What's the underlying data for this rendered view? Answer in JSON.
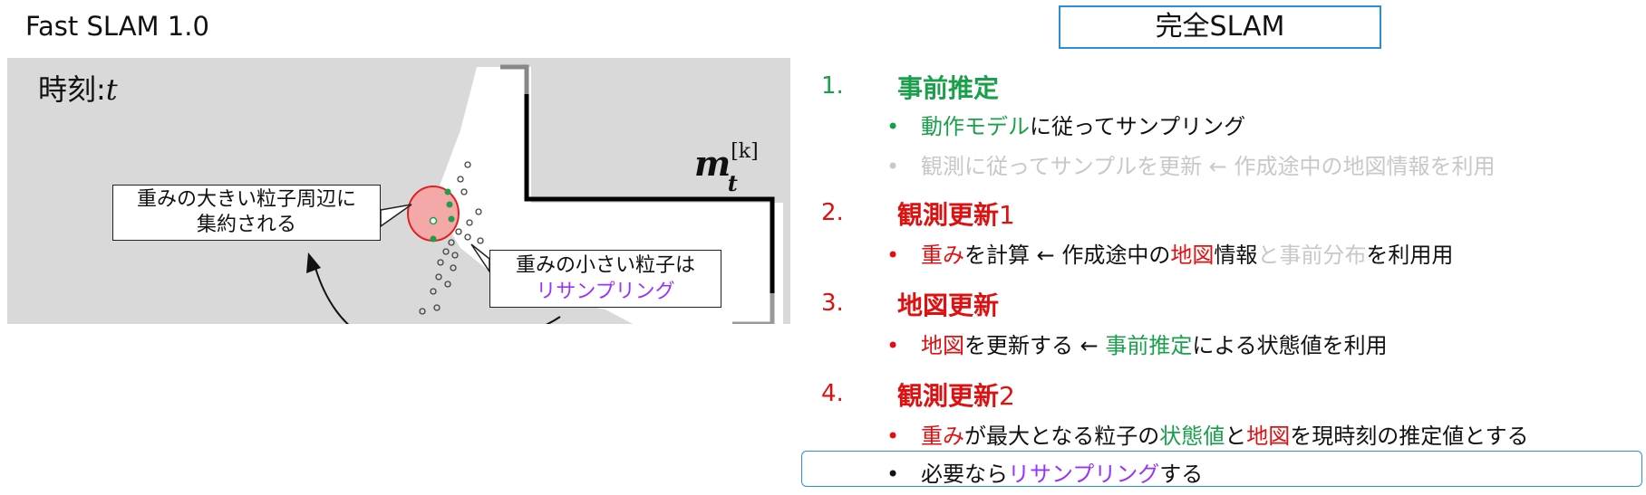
{
  "page_title": "Fast SLAM 1.0",
  "diagram": {
    "time_prefix": "時刻:",
    "time_var": "t",
    "map_symbol": "m",
    "map_superscript": "[k]",
    "map_subscript": "t",
    "callout_large_line1": "重みの大きい粒子周辺に",
    "callout_large_line2": "集約される",
    "callout_small_line1": "重みの小さい粒子は",
    "callout_small_line2": "リサンプリング"
  },
  "panel": {
    "header": "完全SLAM",
    "steps": [
      {
        "number": "1.",
        "title": "事前推定"
      },
      {
        "number": "2.",
        "title": "観測更新",
        "title_suffix": "1"
      },
      {
        "number": "3.",
        "title": "地図更新"
      },
      {
        "number": "4.",
        "title": "観測更新",
        "title_suffix": "2"
      }
    ],
    "bullets": {
      "s1b1": [
        "動作モデル",
        "に従ってサンプリング"
      ],
      "s1b2": [
        "観測に従ってサンプルを更新 ← 作成途中の地図情報を利用"
      ],
      "s2b1": [
        "重み",
        "を計算 ← 作成途中の",
        "地図",
        "情報",
        "と事前分布",
        "を利用用"
      ],
      "s3b1": [
        "地図",
        "を更新する ← ",
        "事前推定",
        "による状態値を利用"
      ],
      "s4b1": [
        "重み",
        "が最大となる粒子の",
        "状態値",
        "と",
        "地図",
        "を現時刻の推定値とする"
      ],
      "s4b2": [
        "必要なら",
        "リサンプリング",
        "する"
      ]
    },
    "bullet_char": "•"
  },
  "colors": {
    "green": "#1aa04a",
    "red": "#e01010",
    "purple": "#9933ff",
    "grey_text": "#c8c8c8",
    "box_blue": "#2a8fd6",
    "map_bg": "#d9d9d9"
  }
}
